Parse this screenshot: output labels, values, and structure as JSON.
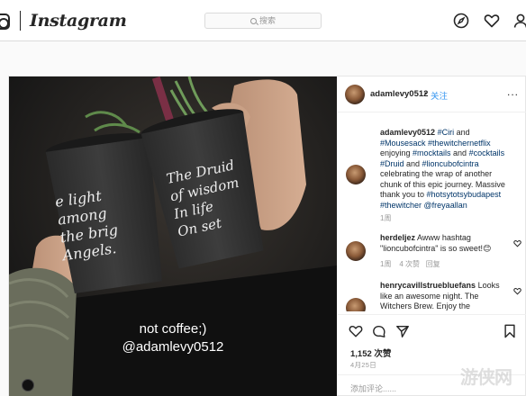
{
  "nav": {
    "logo_text": "Instagram",
    "search_placeholder": "搜索",
    "icons": [
      "instagram-glyph-icon",
      "compass-icon",
      "heart-icon",
      "profile-icon"
    ]
  },
  "post": {
    "overlay_line1": "not coffee;)",
    "overlay_line2": "@adamlevy0512",
    "cup_left_text": "e light\namong\nthe brig\nAngels.",
    "cup_right_text": "The Druid\nof wisdom\nIn life\nOn set",
    "header": {
      "username": "adamlevy0512",
      "separator": "•",
      "follow_label": "关注",
      "more_label": "..."
    },
    "caption": {
      "username": "adamlevy0512",
      "parts": [
        " ",
        "#Ciri",
        " and ",
        "#Mousesack",
        " ",
        "#thewitchernetflix",
        " enjoying ",
        "#mocktails",
        " and ",
        "#cocktails",
        " ",
        "#Druid",
        " and ",
        "#lioncubofcintra",
        " celebrating the wrap of another chunk of this epic journey. Massive thank you to ",
        "#hotsytotsybudapest",
        " ",
        "#thewitcher",
        " ",
        "@freyaallan"
      ],
      "time": "1周"
    },
    "comments": [
      {
        "username": "herdeljez",
        "text": "Awww hashtag \"lioncubofcintra\" is so sweet!😊",
        "time": "1周",
        "likes": "4 次赞",
        "reply": "回复"
      },
      {
        "username": "henrycavillstruebluefans",
        "text": "Looks like an awesome night. The Witchers Brew. Enjoy the celebrations 🐱☕"
      }
    ],
    "likes": "1,152 次赞",
    "date": "4月25日",
    "add_comment_placeholder": "添加评论......"
  },
  "watermark": "游侠网",
  "colors": {
    "link": "#3897f0",
    "hashtag": "#003569",
    "border": "#dbdbdb"
  }
}
